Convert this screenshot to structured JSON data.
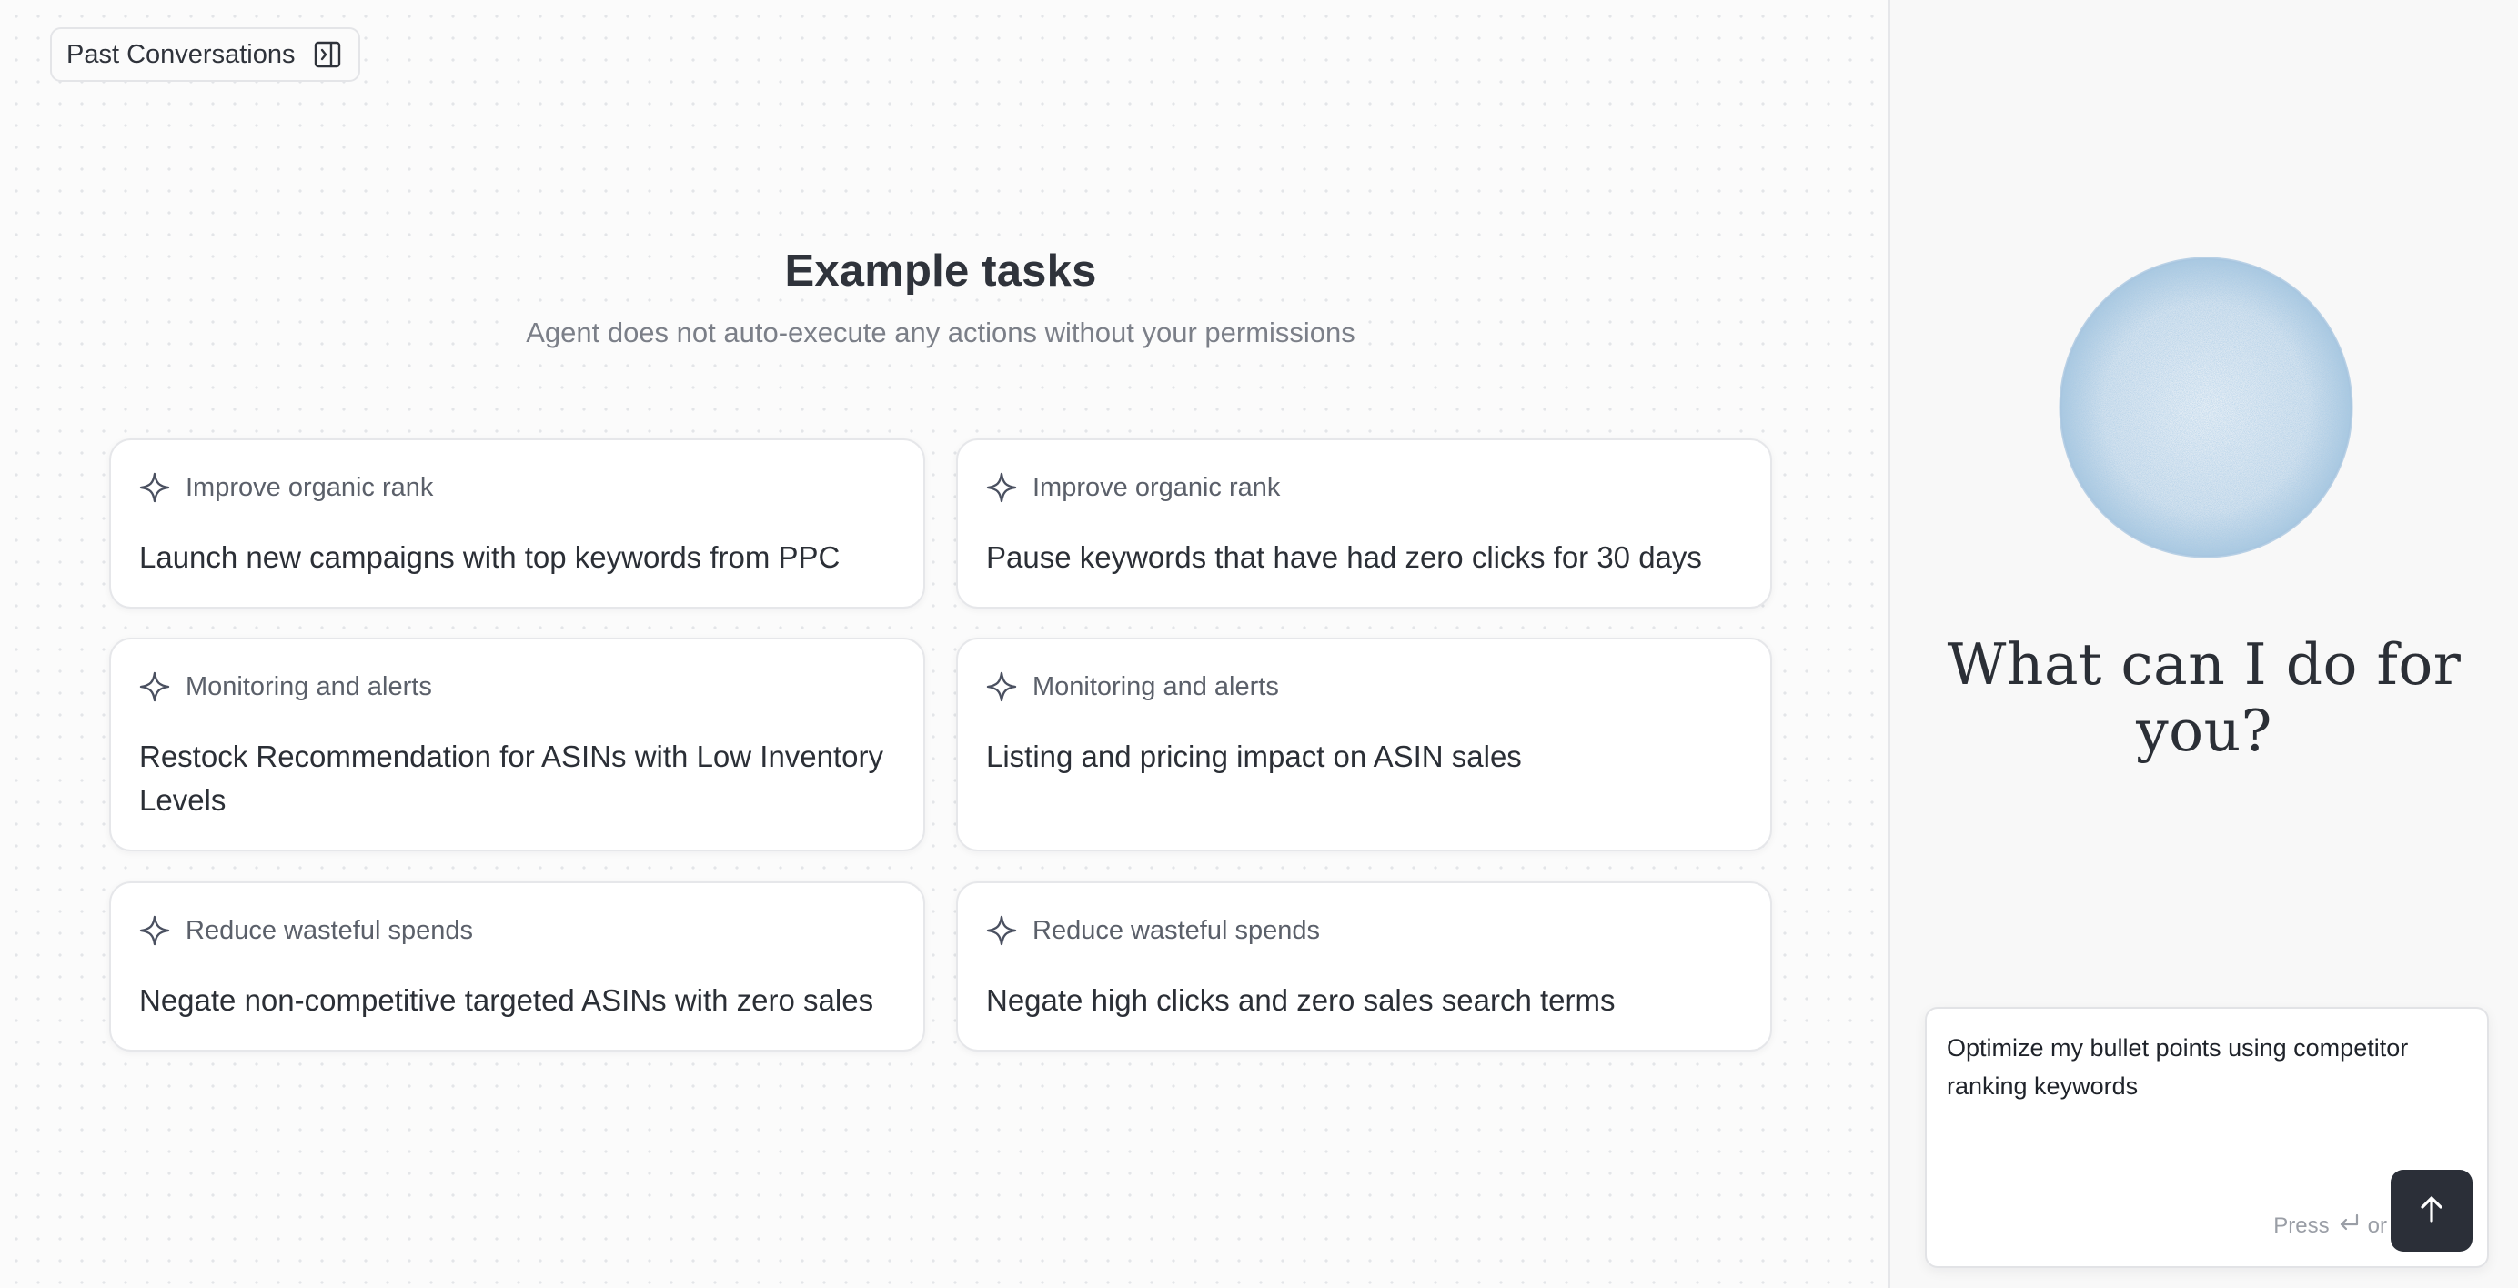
{
  "header": {
    "past_conversations_label": "Past Conversations"
  },
  "hero": {
    "title": "Example tasks",
    "subtitle": "Agent does not auto-execute any actions without your permissions"
  },
  "cards": [
    {
      "category": "Improve organic rank",
      "title": "Launch new campaigns with top keywords from PPC"
    },
    {
      "category": "Improve organic rank",
      "title": "Pause keywords that have had zero clicks for 30 days"
    },
    {
      "category": "Monitoring and alerts",
      "title": "Restock Recommendation for ASINs with Low Inventory Levels"
    },
    {
      "category": "Monitoring and alerts",
      "title": "Listing and pricing impact on ASIN sales"
    },
    {
      "category": "Reduce wasteful spends",
      "title": "Negate non-competitive targeted ASINs with zero sales"
    },
    {
      "category": "Reduce wasteful spends",
      "title": "Negate high clicks and zero sales search terms"
    }
  ],
  "assistant": {
    "greeting": "What can I do for you?",
    "input_value": "Optimize my bullet points using competitor ranking keywords",
    "hint_press": "Press",
    "hint_or": "or"
  },
  "colors": {
    "send_button": "#2b2f38",
    "orb": "#8fb8d8",
    "card_border": "#e6e7ea"
  },
  "icons": {
    "past_conversations": "sidebar-panel-icon",
    "card_tag": "sparkle-icon",
    "enter_key": "enter-key-icon",
    "send": "arrow-up-icon"
  }
}
